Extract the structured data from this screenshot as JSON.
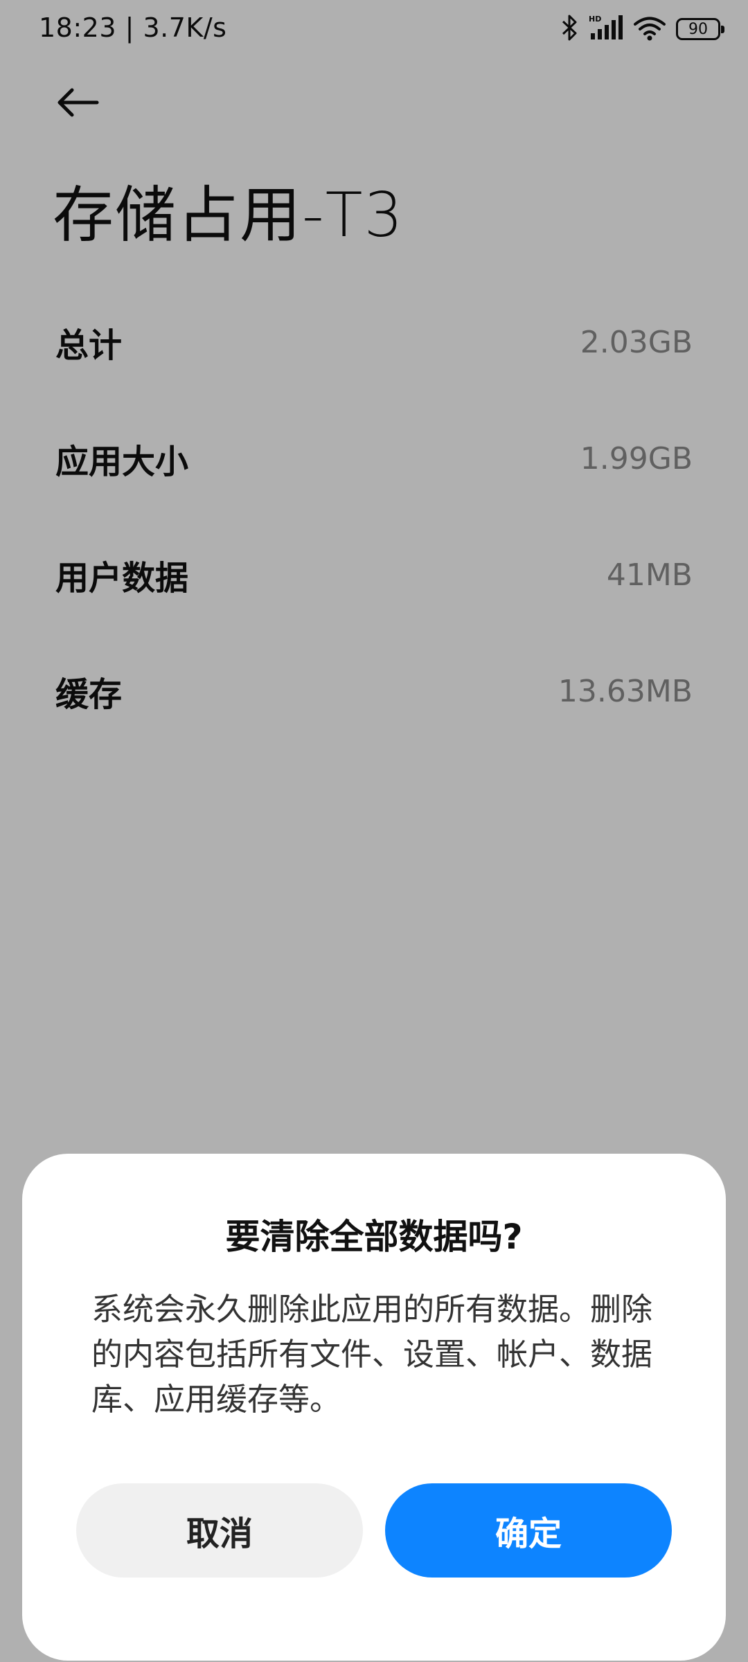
{
  "status_bar": {
    "time_speed": "18:23 | 3.7K/s",
    "battery_level": "90",
    "icons": [
      "bluetooth-icon",
      "hd-signal-icon",
      "wifi-icon",
      "battery-icon"
    ]
  },
  "header": {
    "title": "存储占用-T3"
  },
  "storage": {
    "rows": [
      {
        "label": "总计",
        "value": "2.03GB"
      },
      {
        "label": "应用大小",
        "value": "1.99GB"
      },
      {
        "label": "用户数据",
        "value": "41MB"
      },
      {
        "label": "缓存",
        "value": "13.63MB"
      }
    ]
  },
  "dialog": {
    "title": "要清除全部数据吗?",
    "message": "系统会永久删除此应用的所有数据。删除的内容包括所有文件、设置、帐户、数据库、应用缓存等。",
    "cancel_label": "取消",
    "confirm_label": "确定"
  },
  "colors": {
    "accent": "#0d84ff",
    "overlay": "#000000"
  }
}
